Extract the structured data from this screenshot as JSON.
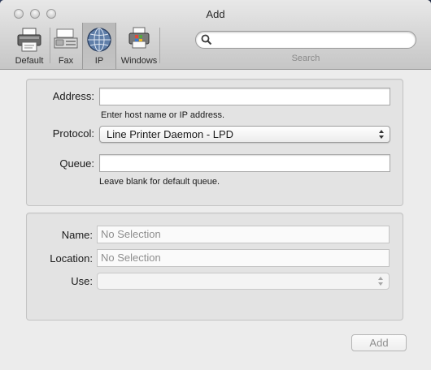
{
  "window": {
    "title": "Add"
  },
  "toolbar": {
    "items": [
      {
        "label": "Default",
        "icon": "printer-icon"
      },
      {
        "label": "Fax",
        "icon": "fax-icon"
      },
      {
        "label": "IP",
        "icon": "globe-icon",
        "selected": true
      },
      {
        "label": "Windows",
        "icon": "windows-printer-icon"
      }
    ],
    "search": {
      "value": "",
      "placeholder": "",
      "caption": "Search"
    }
  },
  "connection": {
    "address": {
      "label": "Address:",
      "value": "",
      "hint": "Enter host name or IP address."
    },
    "protocol": {
      "label": "Protocol:",
      "selected": "Line Printer Daemon - LPD"
    },
    "queue": {
      "label": "Queue:",
      "value": "",
      "hint": "Leave blank for default queue."
    }
  },
  "details": {
    "name": {
      "label": "Name:",
      "value": "No Selection"
    },
    "location": {
      "label": "Location:",
      "value": "No Selection"
    },
    "use": {
      "label": "Use:",
      "selected": ""
    }
  },
  "footer": {
    "add_label": "Add"
  },
  "colors": {
    "window_bg": "#ececec",
    "group_bg": "#e3e3e3",
    "disabled_text": "#8e8e8e"
  }
}
